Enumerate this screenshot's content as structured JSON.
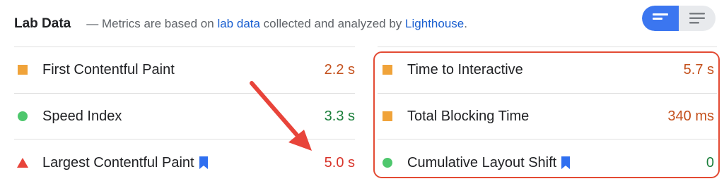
{
  "header": {
    "title": "Lab Data",
    "desc_prefix": "— Metrics are based on ",
    "desc_link1": "lab data",
    "desc_middle": " collected and analyzed by ",
    "desc_link2": "Lighthouse",
    "desc_suffix": "."
  },
  "view_toggle": {
    "selected": "summary"
  },
  "colors": {
    "average": "#f0a33a",
    "good": "#4ec76d",
    "poor": "#e8443a",
    "highlight": "#e34a33",
    "link": "#1a5fd0"
  },
  "metrics_left": [
    {
      "name": "First Contentful Paint",
      "value": "2.2 s",
      "status": "average"
    },
    {
      "name": "Speed Index",
      "value": "3.3 s",
      "status": "good"
    },
    {
      "name": "Largest Contentful Paint",
      "value": "5.0 s",
      "status": "poor"
    }
  ],
  "metrics_right": [
    {
      "name": "Time to Interactive",
      "value": "5.7 s",
      "status": "average"
    },
    {
      "name": "Total Blocking Time",
      "value": "340 ms",
      "status": "average"
    },
    {
      "name": "Cumulative Layout Shift",
      "value": "0",
      "status": "good"
    }
  ]
}
